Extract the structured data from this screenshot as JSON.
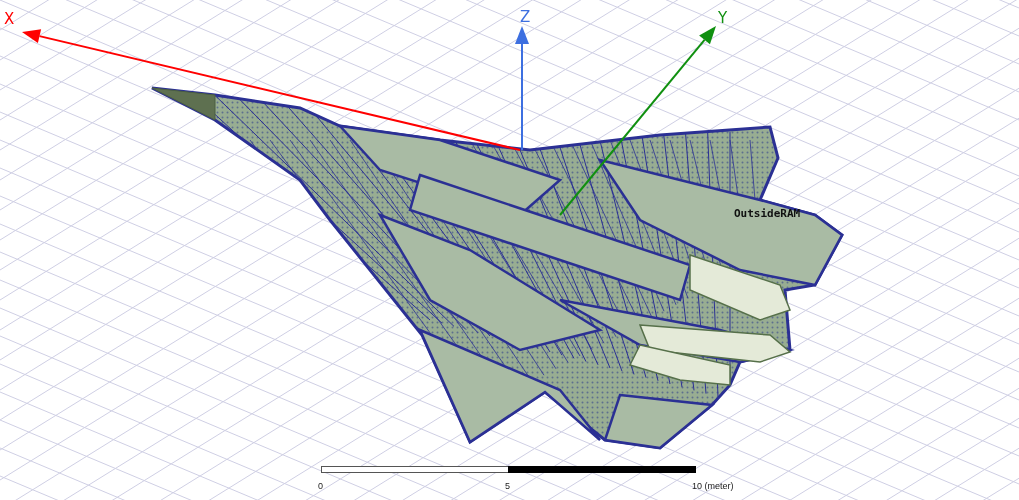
{
  "viewport": {
    "axes": [
      {
        "label": "X",
        "color": "#ff0000"
      },
      {
        "label": "Z",
        "color": "#3d6fe0"
      },
      {
        "label": "Y",
        "color": "#109010"
      }
    ],
    "object_label": "OutsideRAM",
    "scale_bar": {
      "ticks": [
        "0",
        "5",
        "10 (meter)"
      ]
    }
  }
}
